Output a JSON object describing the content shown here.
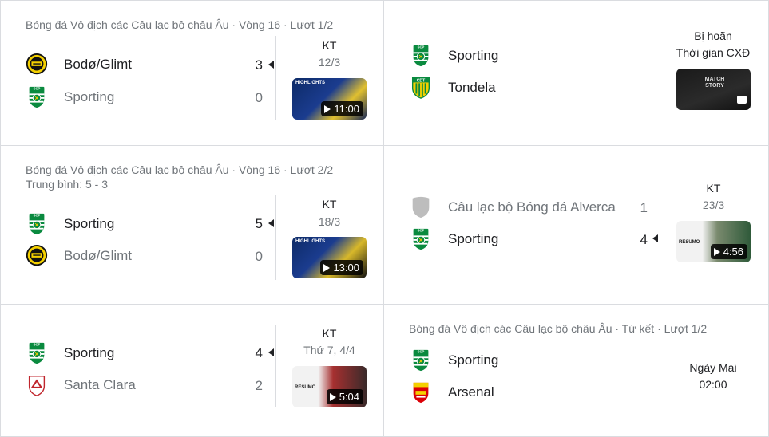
{
  "colors": {
    "sporting_green": "#0a8a3f",
    "bodo_yellow": "#f4d000",
    "text_primary": "#202124",
    "text_secondary": "#70757a",
    "divider": "#dadce0"
  },
  "matches": [
    {
      "meta": "Bóng đá Vô địch các Câu lạc bộ châu Âu · Vòng 16 · Lượt 1/2",
      "meta2": "",
      "home": {
        "name": "Bodø/Glimt",
        "score": "3",
        "logo": "bodo-glimt-logo",
        "winner": true
      },
      "away": {
        "name": "Sporting",
        "score": "0",
        "logo": "sporting-logo",
        "winner": false
      },
      "status": "KT",
      "date": "12/3",
      "video": {
        "duration": "11:00",
        "label": "HIGHLIGHTS"
      }
    },
    {
      "meta": "",
      "meta2": "",
      "home": {
        "name": "Sporting",
        "score": "",
        "logo": "sporting-logo",
        "winner": true
      },
      "away": {
        "name": "Tondela",
        "score": "",
        "logo": "tondela-logo",
        "winner": true
      },
      "status": "Bị hoãn",
      "date": "Thời gian CXĐ",
      "video": {
        "duration": "",
        "label": "MATCH STORY"
      }
    },
    {
      "meta": "Bóng đá Vô địch các Câu lạc bộ châu Âu · Vòng 16 · Lượt 2/2",
      "meta2": "Trung bình: 5 - 3",
      "home": {
        "name": "Sporting",
        "score": "5",
        "logo": "sporting-logo",
        "winner": true
      },
      "away": {
        "name": "Bodø/Glimt",
        "score": "0",
        "logo": "bodo-glimt-logo",
        "winner": false
      },
      "status": "KT",
      "date": "18/3",
      "video": {
        "duration": "13:00",
        "label": "HIGHLIGHTS"
      }
    },
    {
      "meta": "",
      "meta2": "",
      "home": {
        "name": "Câu lạc bộ Bóng đá Alverca",
        "score": "1",
        "logo": "alverca-logo",
        "winner": false
      },
      "away": {
        "name": "Sporting",
        "score": "4",
        "logo": "sporting-logo",
        "winner": true
      },
      "status": "KT",
      "date": "23/3",
      "video": {
        "duration": "4:56",
        "label": "RESUMO"
      }
    },
    {
      "meta": "",
      "meta2": "",
      "home": {
        "name": "Sporting",
        "score": "4",
        "logo": "sporting-logo",
        "winner": true
      },
      "away": {
        "name": "Santa Clara",
        "score": "2",
        "logo": "santa-clara-logo",
        "winner": false
      },
      "status": "KT",
      "date": "Thứ 7, 4/4",
      "video": {
        "duration": "5:04",
        "label": "RESUMO"
      }
    },
    {
      "meta": "Bóng đá Vô địch các Câu lạc bộ châu Âu · Tứ kết · Lượt 1/2",
      "meta2": "",
      "home": {
        "name": "Sporting",
        "score": "",
        "logo": "sporting-logo",
        "winner": true
      },
      "away": {
        "name": "Arsenal",
        "score": "",
        "logo": "arsenal-logo",
        "winner": true
      },
      "status": "Ngày Mai",
      "date": "02:00",
      "video": null
    }
  ]
}
